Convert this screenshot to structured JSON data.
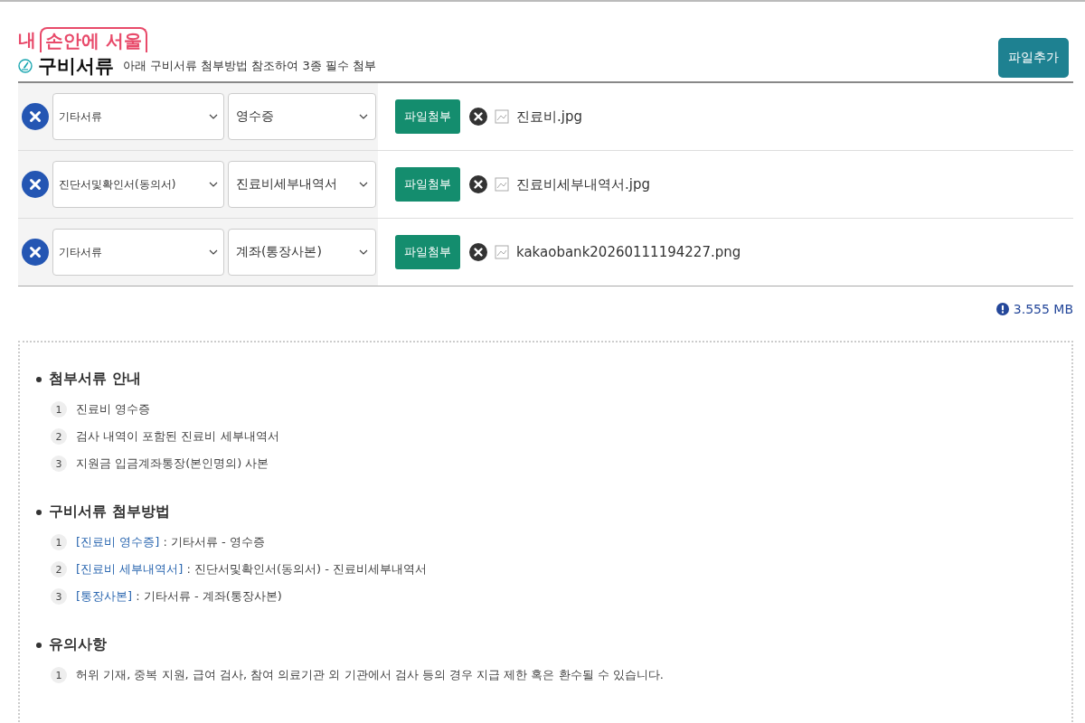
{
  "logo": {
    "prefix": "내",
    "boxed": "손안에 서울"
  },
  "section": {
    "title": "구비서류",
    "subtitle": "아래 구비서류 첨부방법 참조하여 3종 필수 첨부",
    "add_button": "파일추가"
  },
  "attachments": [
    {
      "category": "기타서류",
      "document": "영수증",
      "attach_button": "파일첨부",
      "file": "진료비.jpg"
    },
    {
      "category": "진단서및확인서(동의서)",
      "document": "진료비세부내역서",
      "attach_button": "파일첨부",
      "file": "진료비세부내역서.jpg"
    },
    {
      "category": "기타서류",
      "document": "계좌(통장사본)",
      "attach_button": "파일첨부",
      "file": "kakaobank20260111194227.png"
    }
  ],
  "total_size": "3.555 MB",
  "guide": [
    {
      "heading": "첨부서류 안내",
      "items": [
        {
          "num": "1",
          "text": "진료비 영수증"
        },
        {
          "num": "2",
          "text": "검사 내역이 포함된 진료비 세부내역서"
        },
        {
          "num": "3",
          "text": "지원금 입금계좌통장(본인명의) 사본"
        }
      ]
    },
    {
      "heading": "구비서류 첨부방법",
      "items": [
        {
          "num": "1",
          "link": "[진료비 영수증]",
          "text": " : 기타서류 - 영수증"
        },
        {
          "num": "2",
          "link": "[진료비 세부내역서]",
          "text": " : 진단서및확인서(동의서) - 진료비세부내역서"
        },
        {
          "num": "3",
          "link": "[통장사본]",
          "text": " : 기타서류 - 계좌(통장사본)"
        }
      ]
    },
    {
      "heading": "유의사항",
      "items": [
        {
          "num": "1",
          "text": "허위 기재, 중복 지원, 급여 검사, 참여 의료기관 외 기관에서 검사 등의 경우 지급 제한 혹은 환수될 수 있습니다."
        }
      ]
    }
  ]
}
